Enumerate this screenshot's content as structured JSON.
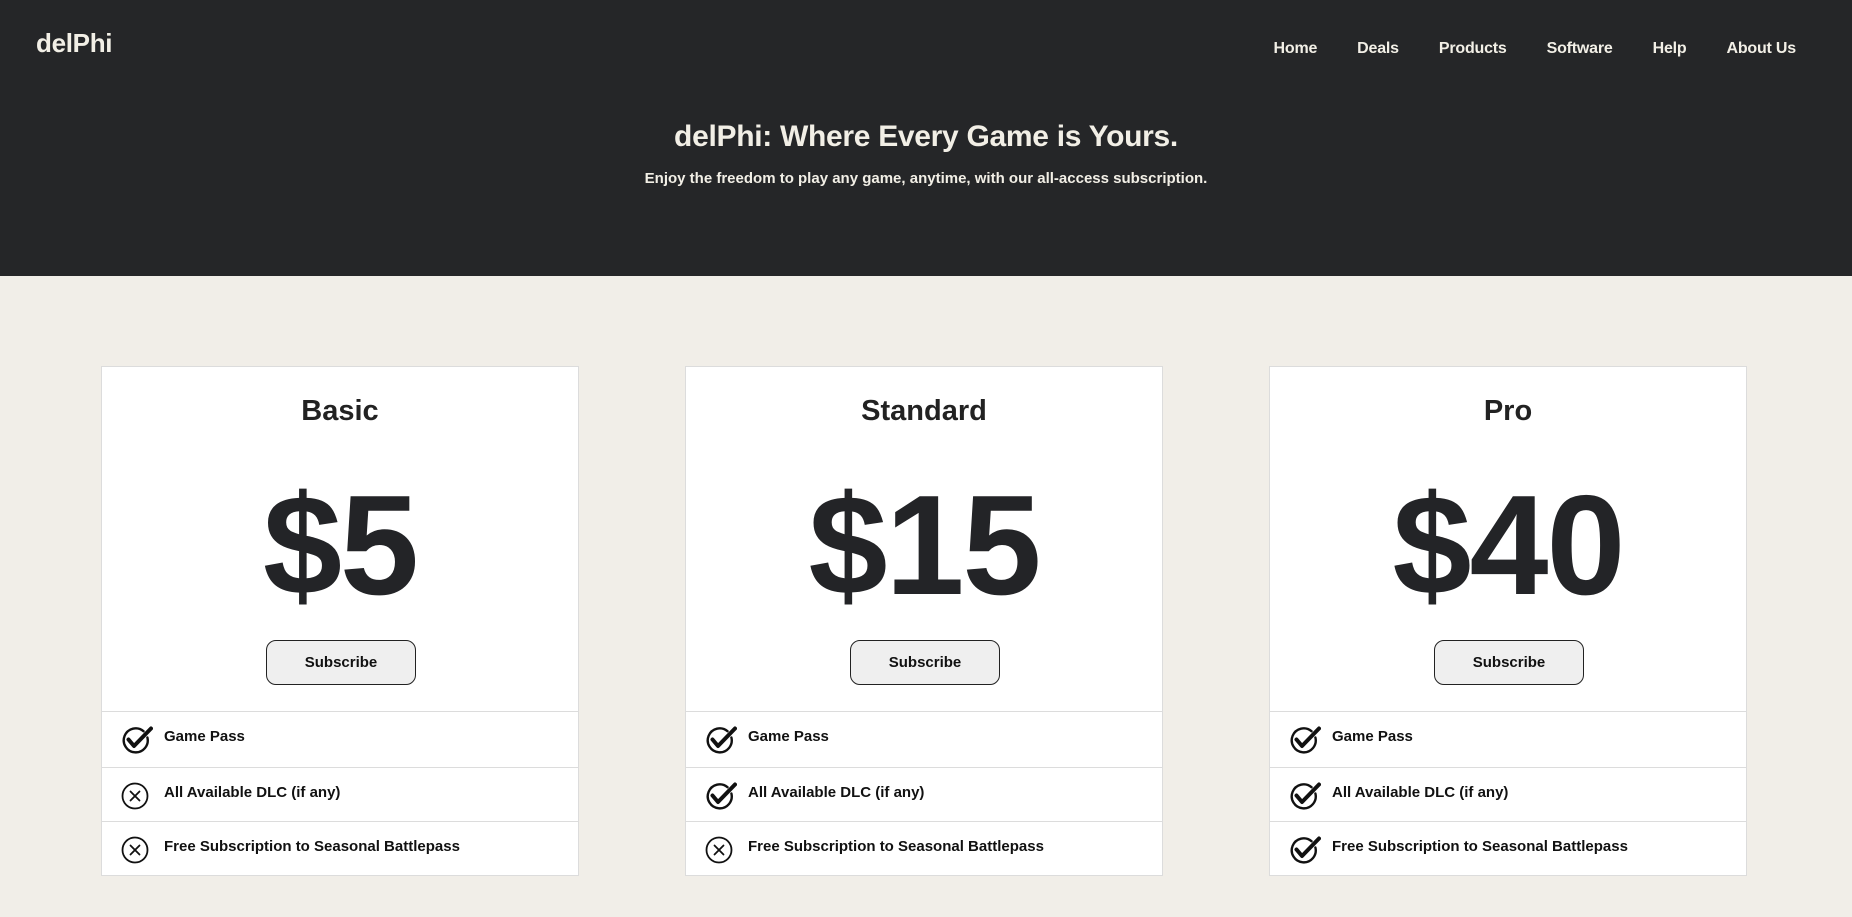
{
  "brand": "delPhi",
  "nav": [
    "Home",
    "Deals",
    "Products",
    "Software",
    "Help",
    "About Us"
  ],
  "hero": {
    "headline": "delPhi: Where Every Game is Yours.",
    "tagline": "Enjoy the freedom to play any game, anytime, with our all-access subscription."
  },
  "plans": [
    {
      "name": "Basic",
      "price": "$5",
      "cta": "Subscribe",
      "features": [
        {
          "label": "Game Pass",
          "included": true
        },
        {
          "label": "All Available DLC (if any)",
          "included": false
        },
        {
          "label": "Free Subscription to Seasonal Battlepass",
          "included": false
        }
      ]
    },
    {
      "name": "Standard",
      "price": "$15",
      "cta": "Subscribe",
      "features": [
        {
          "label": "Game Pass",
          "included": true
        },
        {
          "label": "All Available DLC (if any)",
          "included": true
        },
        {
          "label": "Free Subscription to Seasonal Battlepass",
          "included": false
        }
      ]
    },
    {
      "name": "Pro",
      "price": "$40",
      "cta": "Subscribe",
      "features": [
        {
          "label": "Game Pass",
          "included": true
        },
        {
          "label": "All Available DLC (if any)",
          "included": true
        },
        {
          "label": "Free Subscription to Seasonal Battlepass",
          "included": true
        }
      ]
    }
  ],
  "colors": {
    "header_bg": "#252628",
    "page_bg": "#f1eee8",
    "header_text": "#f2efe6",
    "card_bg": "#ffffff"
  },
  "icons": {
    "included": "check-circle-icon",
    "excluded": "x-circle-icon"
  }
}
